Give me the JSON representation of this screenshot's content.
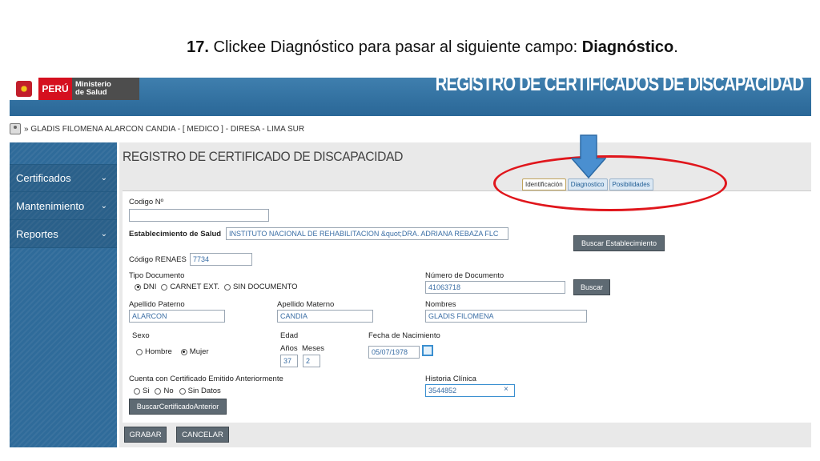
{
  "slide": {
    "step_number": "17.",
    "instruction": " Clickee Diagnóstico para pasar al siguiente campo: ",
    "field_name": "Diagnóstico",
    "end": "."
  },
  "header": {
    "logo_country": "PERÚ",
    "logo_ministry": "Ministerio\nde Salud",
    "app_title": "REGISTRO DE CERTIFICADOS DE DISCAPACIDAD"
  },
  "user_bar": {
    "text": "» GLADIS FILOMENA ALARCON CANDIA - [ MEDICO ] - DIRESA - LIMA SUR"
  },
  "sidebar": {
    "items": [
      {
        "label": "Certificados"
      },
      {
        "label": "Mantenimiento"
      },
      {
        "label": "Reportes"
      }
    ],
    "chevron": "⌄"
  },
  "main": {
    "title": "REGISTRO DE CERTIFICADO DE DISCAPACIDAD",
    "tabs": [
      {
        "label": "Identificación",
        "active": true
      },
      {
        "label": "Diagnostico",
        "active": false
      },
      {
        "label": "Posibilidades",
        "active": false
      }
    ]
  },
  "form": {
    "codigo_label": "Codigo Nº",
    "codigo_value": "",
    "establecimiento_label": "Establecimiento de Salud",
    "establecimiento_value": "INSTITUTO NACIONAL DE REHABILITACION &quot;DRA. ADRIANA REBAZA FLC",
    "buscar_establecimiento": "Buscar Establecimiento",
    "renaes_label": "Código RENAES",
    "renaes_value": "7734",
    "tipo_doc_label": "Tipo Documento",
    "tipo_doc_options": [
      "DNI",
      "CARNET EXT.",
      "SIN DOCUMENTO"
    ],
    "tipo_doc_selected": "DNI",
    "numero_doc_label": "Número de Documento",
    "numero_doc_value": "41063718",
    "buscar": "Buscar",
    "apellido_paterno_label": "Apellido Paterno",
    "apellido_paterno_value": "ALARCON",
    "apellido_materno_label": "Apellido Materno",
    "apellido_materno_value": "CANDIA",
    "nombres_label": "Nombres",
    "nombres_value": "GLADIS FILOMENA",
    "sexo_label": "Sexo",
    "sexo_options": [
      "Hombre",
      "Mujer"
    ],
    "sexo_selected": "Mujer",
    "edad_label": "Edad",
    "anios_label": "Años",
    "meses_label": "Meses",
    "anios_value": "37",
    "meses_value": "2",
    "fecha_nac_label": "Fecha de Nacimiento",
    "fecha_nac_value": "05/07/1978",
    "certificado_label": "Cuenta con Certificado Emitido Anteriormente",
    "certificado_options": [
      "Si",
      "No",
      "Sin Datos"
    ],
    "historia_label": "Historia Clínica",
    "historia_value": "3544852",
    "clear_icon": "×",
    "buscar_certificado": "BuscarCertificadoAnterior"
  },
  "footer": {
    "grabar": "GRABAR",
    "cancelar": "CANCELAR"
  },
  "colors": {
    "annotation_ellipse": "#e0161c",
    "annotation_arrow": "#4a8fd0",
    "header_blue": "#2a6797",
    "sidebar_blue": "#2f6b9a"
  }
}
